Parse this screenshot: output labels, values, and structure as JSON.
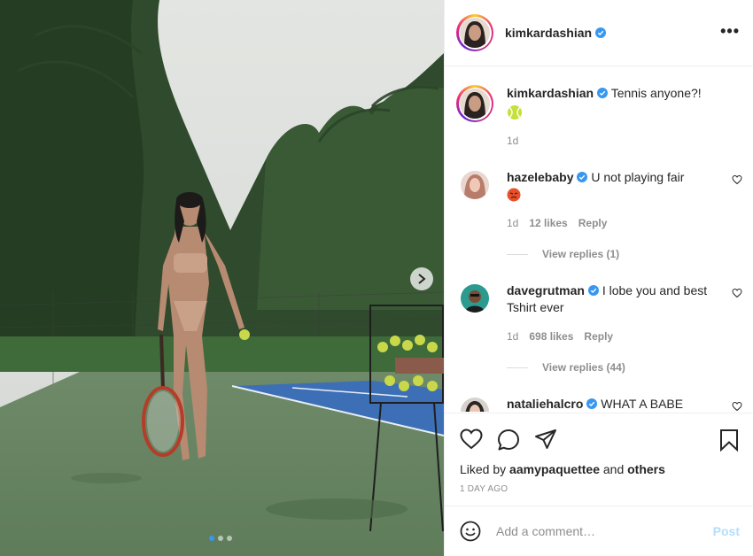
{
  "post": {
    "username": "kimkardashian",
    "caption": "Tennis anyone?!",
    "caption_emoji": "tennis-ball-emoji",
    "caption_age": "1d",
    "liked_by_user": "aamypaquettee",
    "liked_by_suffix": "others",
    "liked_by_prefix": "Liked by",
    "liked_by_and": "and",
    "date": "1 DAY AGO",
    "carousel": {
      "slides": 3,
      "active": 0
    }
  },
  "comments": [
    {
      "username": "hazelebaby",
      "text": "U not playing fair",
      "emoji": "angry-face-emoji",
      "age": "1d",
      "likes": "12 likes",
      "reply": "Reply",
      "view_replies": "View replies (1)"
    },
    {
      "username": "davegrutman",
      "text": "I lobe you and best Tshirt ever",
      "age": "1d",
      "likes": "698 likes",
      "reply": "Reply",
      "view_replies": "View replies (44)"
    },
    {
      "username": "nataliehalcro",
      "text": "WHAT A BABE"
    }
  ],
  "composer": {
    "placeholder": "Add a comment…",
    "post_label": "Post"
  },
  "colors": {
    "verified": "#3897f0",
    "post_disabled": "#b2dffc",
    "muted": "#8e8e8e",
    "text": "#262626"
  }
}
